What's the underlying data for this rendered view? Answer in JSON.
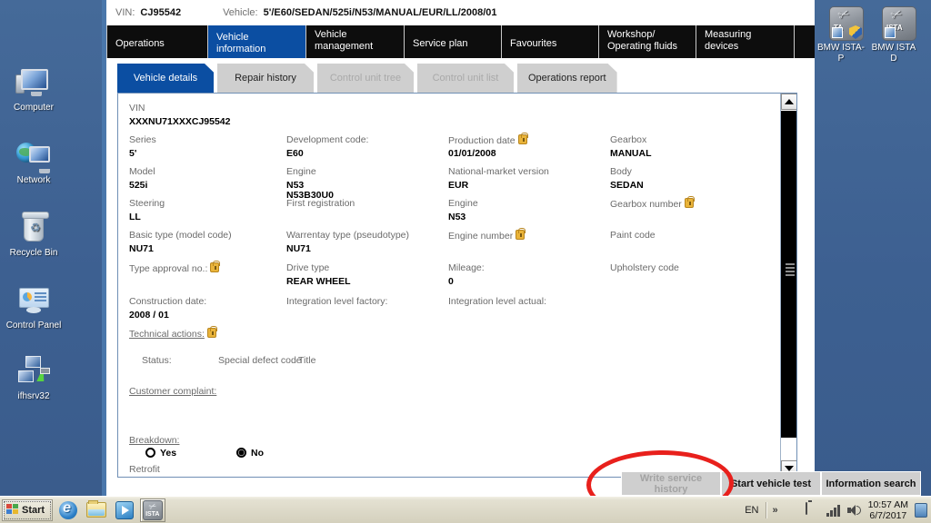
{
  "desktop": {
    "icons_left": [
      {
        "label": "Computer",
        "icon": "computer-icon"
      },
      {
        "label": "Network",
        "icon": "network-icon"
      },
      {
        "label": "Recycle Bin",
        "icon": "recycle-bin-icon"
      },
      {
        "label": "Control Panel",
        "icon": "control-panel-icon"
      },
      {
        "label": "ifhsrv32",
        "icon": "server-shortcut-icon"
      }
    ],
    "icons_right": [
      {
        "label": "BMW ISTA-P",
        "icon": "bmw-ista-p-icon"
      },
      {
        "label": "BMW ISTA D",
        "icon": "bmw-ista-d-icon"
      }
    ]
  },
  "app": {
    "vin_bar": {
      "vin_label": "VIN:",
      "vin_value": "CJ95542",
      "vehicle_label": "Vehicle:",
      "vehicle_value": "5'/E60/SEDAN/525i/N53/MANUAL/EUR/LL/2008/01"
    },
    "main_tabs": [
      {
        "label": "Operations",
        "selected": false
      },
      {
        "label": "Vehicle information",
        "selected": true
      },
      {
        "label": "Vehicle\nmanagement",
        "line1": "Vehicle",
        "line2": "management",
        "selected": false
      },
      {
        "label": "Service plan",
        "selected": false
      },
      {
        "label": "Favourites",
        "selected": false
      },
      {
        "label": "Workshop/\nOperating fluids",
        "line1": "Workshop/",
        "line2": "Operating fluids",
        "selected": false
      },
      {
        "label": "Measuring\ndevices",
        "line1": "Measuring",
        "line2": "devices",
        "selected": false
      }
    ],
    "sub_tabs": [
      {
        "label": "Vehicle details",
        "state": "selected"
      },
      {
        "label": "Repair history",
        "state": "enabled"
      },
      {
        "label": "Control unit tree",
        "state": "disabled"
      },
      {
        "label": "Control unit list",
        "state": "disabled"
      },
      {
        "label": "Operations report",
        "state": "enabled"
      }
    ],
    "details": {
      "vin_label": "VIN",
      "vin_value": "XXXNU71XXXCJ95542",
      "fields": [
        {
          "label": "Series",
          "value": "5'"
        },
        {
          "label": "Development code:",
          "value": "E60"
        },
        {
          "label": "Production date",
          "value": "01/01/2008",
          "warn": true
        },
        {
          "label": "Gearbox",
          "value": "MANUAL"
        },
        {
          "label": "Model",
          "value": "525i"
        },
        {
          "label": "Engine",
          "value": "N53",
          "value2": "N53B30U0"
        },
        {
          "label": "National-market version",
          "value": "EUR"
        },
        {
          "label": "Body",
          "value": "SEDAN"
        },
        {
          "label": "Steering",
          "value": "LL"
        },
        {
          "label": "First registration",
          "value": ""
        },
        {
          "label": "Engine",
          "value": "N53"
        },
        {
          "label": "Gearbox number",
          "value": "",
          "warn": true
        },
        {
          "label": "Basic type (model code)",
          "value": "NU71"
        },
        {
          "label": "Warrentay type (pseudotype)",
          "value": "NU71"
        },
        {
          "label": "Engine number",
          "value": "",
          "warn": true
        },
        {
          "label": "Paint code",
          "value": ""
        },
        {
          "label": "Type approval no.:",
          "value": "",
          "warn": true
        },
        {
          "label": "Drive type",
          "value": "REAR WHEEL"
        },
        {
          "label": "Mileage:",
          "value": "0"
        },
        {
          "label": "Upholstery code",
          "value": ""
        },
        {
          "label": "Construction date:",
          "value": "2008 / 01"
        },
        {
          "label": "Integration level factory:",
          "value": ""
        },
        {
          "label": "Integration level actual:",
          "value": ""
        }
      ],
      "technical_actions": "Technical actions:",
      "status_label": "Status:",
      "special_defect_code": "Special defect code",
      "title_col": "Title",
      "customer_complaint": "Customer complaint:",
      "breakdown_label": "Breakdown:",
      "breakdown_yes": "Yes",
      "breakdown_no": "No",
      "breakdown_selected": "No",
      "retrofit": "Retrofit"
    },
    "buttons": [
      {
        "label": "Write service history",
        "line1": "Write service",
        "line2": "history",
        "disabled": true
      },
      {
        "label": "Start vehicle test",
        "disabled": false
      },
      {
        "label": "Information search",
        "disabled": false
      }
    ],
    "annotation": {
      "shape": "red-ellipse",
      "color": "#e8201c",
      "target": "Start vehicle test"
    }
  },
  "taskbar": {
    "start_label": "Start",
    "quicklaunch": [
      {
        "name": "internet-explorer-icon"
      },
      {
        "name": "windows-explorer-icon"
      },
      {
        "name": "windows-media-player-icon"
      },
      {
        "name": "ista-window-icon",
        "active": true
      }
    ],
    "tray": {
      "language": "EN",
      "show_hidden": "»",
      "icons": [
        "action-center-shield-icon",
        "battery-icon",
        "network-signal-icon",
        "volume-icon"
      ],
      "time": "10:57 AM",
      "date": "6/7/2017"
    }
  },
  "colors": {
    "desktop": "#3d6091",
    "accent_blue": "#0b4ea2",
    "tabbar_black": "#0d0d0d",
    "annotation_red": "#e8201c",
    "tab_grey": "#cfcfcf"
  }
}
